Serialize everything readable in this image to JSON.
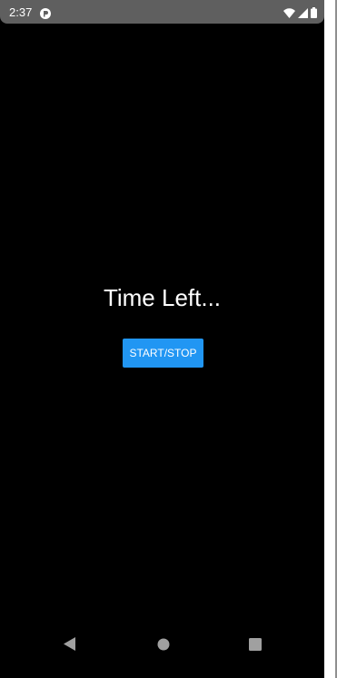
{
  "status_bar": {
    "time": "2:37",
    "icons": [
      "app-notification-icon",
      "wifi-icon",
      "signal-icon",
      "battery-icon"
    ]
  },
  "main": {
    "time_left_label": "Time Left...",
    "start_stop_label": "START/STOP"
  },
  "nav_bar": {
    "buttons": [
      "back-icon",
      "home-icon",
      "recents-icon"
    ]
  },
  "colors": {
    "background": "#000000",
    "status_bar": "#5f5f5f",
    "button": "#2196f3",
    "text": "#ffffff",
    "nav_icons": "#a0a0a0"
  }
}
